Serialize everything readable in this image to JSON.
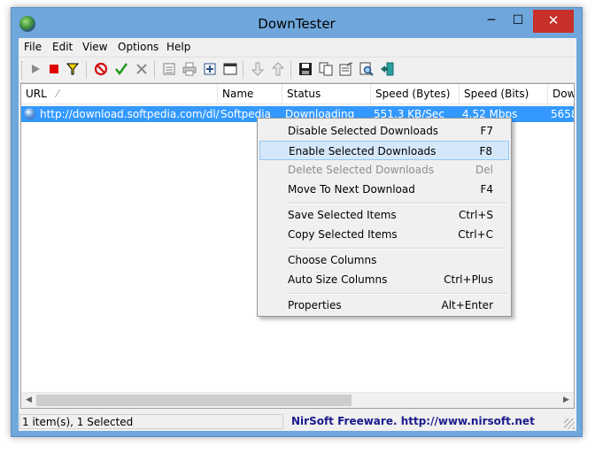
{
  "window": {
    "title": "DownTester",
    "controls": {
      "minimize": "─",
      "maximize": "☐",
      "close": "✕"
    }
  },
  "menu": [
    "File",
    "Edit",
    "View",
    "Options",
    "Help"
  ],
  "toolbar": {
    "icons": [
      "play-icon",
      "stop-icon",
      "filter-icon",
      "cancel-icon",
      "check-icon",
      "delete-icon",
      "list-icon",
      "print-icon",
      "add-icon",
      "window-icon",
      "arrow-down-icon",
      "arrow-up-icon",
      "save-icon",
      "copy-icon",
      "properties-icon",
      "find-icon",
      "exit-icon"
    ],
    "colors": {
      "stop": "#e00000",
      "check": "#1a9a1a",
      "cancel": "#d01010"
    }
  },
  "list": {
    "columns": [
      "URL",
      "Name",
      "Status",
      "Speed (Bytes)",
      "Speed (Bits)",
      "Dow"
    ],
    "sort_indicator": "⁄",
    "rows": [
      {
        "url": "http://download.softpedia.com/dl/...",
        "name": "Softpedia",
        "status": "Downloading",
        "speed_bytes": "551.3 KB/Sec",
        "speed_bits": "4.52 Mbps",
        "downloaded": "5658"
      }
    ],
    "selection_color": "#3399ff"
  },
  "context_menu": {
    "items": [
      {
        "label": "Disable Selected Downloads",
        "key": "F7",
        "state": "normal"
      },
      {
        "label": "Enable Selected Downloads",
        "key": "F8",
        "state": "highlighted"
      },
      {
        "label": "Delete Selected Downloads",
        "key": "Del",
        "state": "disabled"
      },
      {
        "label": "Move To Next Download",
        "key": "F4",
        "state": "normal"
      },
      {
        "separator": true
      },
      {
        "label": "Save Selected Items",
        "key": "Ctrl+S",
        "state": "normal"
      },
      {
        "label": "Copy Selected Items",
        "key": "Ctrl+C",
        "state": "normal"
      },
      {
        "separator": true
      },
      {
        "label": "Choose Columns",
        "key": "",
        "state": "normal"
      },
      {
        "label": "Auto Size Columns",
        "key": "Ctrl+Plus",
        "state": "normal"
      },
      {
        "separator": true
      },
      {
        "label": "Properties",
        "key": "Alt+Enter",
        "state": "normal"
      }
    ]
  },
  "status": {
    "left": "1 item(s), 1 Selected",
    "right": "NirSoft Freeware.  http://www.nirsoft.net"
  },
  "scroll": {
    "left_arrow": "◀",
    "right_arrow": "▶"
  },
  "colors": {
    "title_bar": "#6fa7dc",
    "close_button": "#c7302b",
    "menu_highlight": "#d5e8fa",
    "status_link": "#1a1a8c"
  }
}
